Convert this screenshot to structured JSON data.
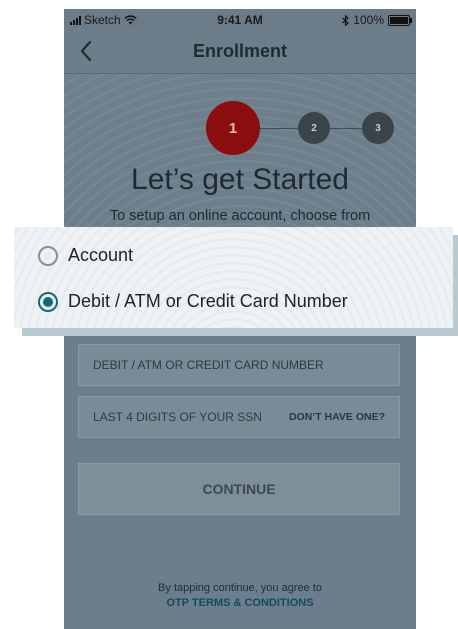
{
  "status_bar": {
    "carrier": "Sketch",
    "time": "9:41 AM",
    "battery": "100%"
  },
  "nav": {
    "title": "Enrollment",
    "back_icon": "chevron-left-icon"
  },
  "steps": [
    "1",
    "2",
    "3"
  ],
  "headline": "Let’s get Started",
  "subtext": "To setup an online account, choose from",
  "options": [
    {
      "label": "Account",
      "selected": false
    },
    {
      "label": "Debit / ATM or Credit Card Number",
      "selected": true
    }
  ],
  "fields": {
    "card_placeholder": "DEBIT / ATM OR CREDIT CARD NUMBER",
    "ssn_placeholder": "LAST 4 DIGITS OF YOUR SSN",
    "dont_have": "DON’T HAVE ONE?"
  },
  "continue_label": "CONTINUE",
  "terms": {
    "text": "By tapping continue, you agree to",
    "link": "OTP TERMS & CONDITIONS"
  },
  "colors": {
    "accent": "#0c6e73",
    "active_step": "#8b0d0d",
    "background": "#6b7e8c"
  }
}
